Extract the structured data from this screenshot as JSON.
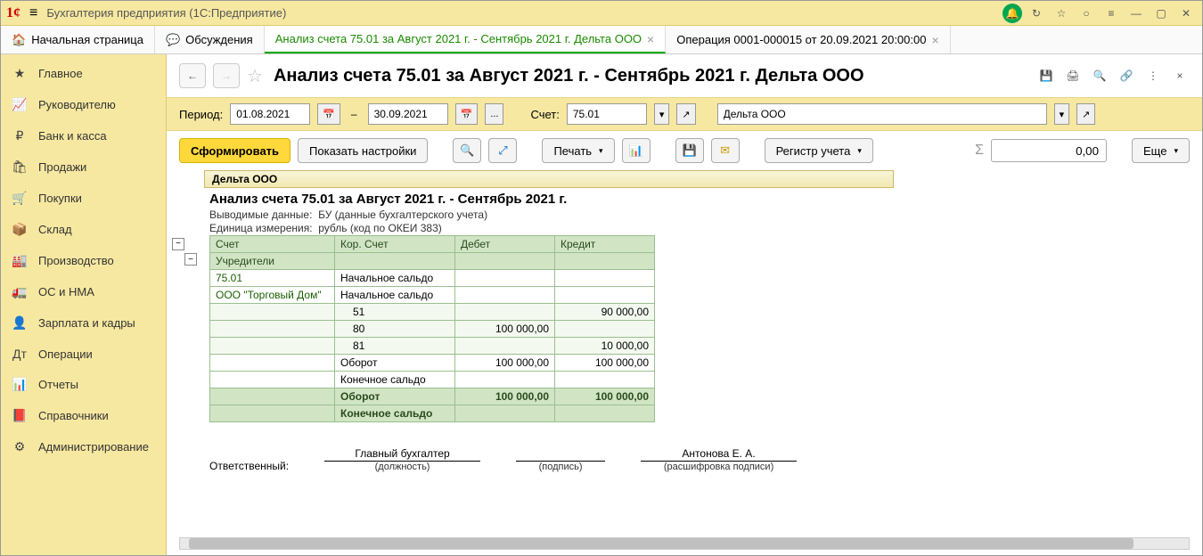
{
  "app_title": "Бухгалтерия предприятия  (1С:Предприятие)",
  "tabs": [
    {
      "icon": "🏠",
      "label": "Начальная страница"
    },
    {
      "icon": "💬",
      "label": "Обсуждения"
    },
    {
      "icon": "",
      "label": "Анализ счета 75.01 за Август 2021 г. - Сентябрь 2021 г. Дельта ООО",
      "closable": true,
      "active": true
    },
    {
      "icon": "",
      "label": "Операция 0001-000015 от 20.09.2021 20:00:00",
      "closable": true
    }
  ],
  "sidebar": {
    "items": [
      {
        "icon": "★",
        "label": "Главное"
      },
      {
        "icon": "📈",
        "label": "Руководителю"
      },
      {
        "icon": "₽",
        "label": "Банк и касса"
      },
      {
        "icon": "🛍",
        "label": "Продажи"
      },
      {
        "icon": "🛒",
        "label": "Покупки"
      },
      {
        "icon": "📦",
        "label": "Склад"
      },
      {
        "icon": "🏭",
        "label": "Производство"
      },
      {
        "icon": "🚛",
        "label": "ОС и НМА"
      },
      {
        "icon": "👤",
        "label": "Зарплата и кадры"
      },
      {
        "icon": "Дт",
        "label": "Операции"
      },
      {
        "icon": "📊",
        "label": "Отчеты"
      },
      {
        "icon": "📕",
        "label": "Справочники"
      },
      {
        "icon": "⚙",
        "label": "Администрирование"
      }
    ]
  },
  "page": {
    "title": "Анализ счета 75.01 за Август 2021 г. - Сентябрь 2021 г. Дельта ООО"
  },
  "params": {
    "period_lbl": "Период:",
    "date_from": "01.08.2021",
    "date_to": "30.09.2021",
    "dots": "...",
    "account_lbl": "Счет:",
    "account": "75.01",
    "org": "Дельта ООО"
  },
  "toolbar": {
    "form": "Сформировать",
    "show_settings": "Показать настройки",
    "print": "Печать",
    "register": "Регистр учета",
    "sum": "0,00",
    "more": "Еще"
  },
  "report": {
    "org": "Дельта ООО",
    "title": "Анализ счета 75.01 за Август 2021 г. - Сентябрь 2021 г.",
    "out_lbl": "Выводимые данные:",
    "out_val": "БУ (данные бухгалтерского учета)",
    "unit_lbl": "Единица измерения:",
    "unit_val": "рубль (код по ОКЕИ 383)",
    "cols": [
      "Счет",
      "Кор. Счет",
      "Дебет",
      "Кредит"
    ],
    "row_sub": "Учредители",
    "rows": [
      {
        "a": "75.01",
        "b": "Начальное сальдо",
        "d": "",
        "c": ""
      },
      {
        "a": "   ООО \"Торговый Дом\"",
        "b": "Начальное сальдо",
        "d": "",
        "c": ""
      },
      {
        "a": "",
        "b": "51",
        "d": "",
        "c": "90 000,00"
      },
      {
        "a": "",
        "b": "80",
        "d": "100 000,00",
        "c": ""
      },
      {
        "a": "",
        "b": "81",
        "d": "",
        "c": "10 000,00"
      },
      {
        "a": "",
        "b": "Оборот",
        "d": "100 000,00",
        "c": "100 000,00"
      },
      {
        "a": "",
        "b": "Конечное сальдо",
        "d": "",
        "c": ""
      }
    ],
    "total_row": {
      "b": "Оборот",
      "d": "100 000,00",
      "c": "100 000,00"
    },
    "final_row": {
      "b": "Конечное сальдо"
    },
    "resp_lbl": "Ответственный:",
    "sign_pos": "Главный бухгалтер",
    "sign_pos_cap": "(должность)",
    "sign_sig_cap": "(подпись)",
    "sign_name": "Антонова Е. А.",
    "sign_name_cap": "(расшифровка подписи)"
  }
}
